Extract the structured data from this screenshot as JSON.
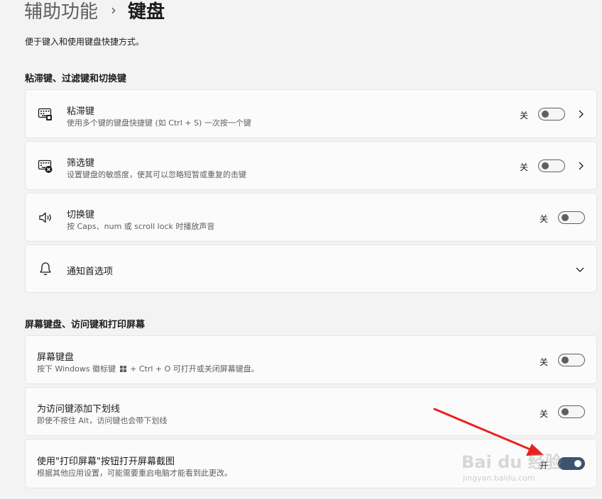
{
  "breadcrumb": {
    "parent": "辅助功能",
    "separator": "›",
    "current": "键盘"
  },
  "description": "便于键入和使用键盘快捷方式。",
  "sections": [
    {
      "title": "粘滞键、过滤键和切换键"
    },
    {
      "title": "屏幕键盘、访问键和打印屏幕"
    }
  ],
  "settings": {
    "sticky_keys": {
      "title": "粘滞键",
      "subtitle": "使用多个键的键盘快捷键 (如 Ctrl + S) 一次按一个键",
      "state": "关",
      "icon": "sticky-keys-icon",
      "on": false
    },
    "filter_keys": {
      "title": "筛选键",
      "subtitle": "设置键盘的敏感度，使其可以忽略短暂或重复的击键",
      "state": "关",
      "icon": "filter-keys-icon",
      "on": false
    },
    "toggle_keys": {
      "title": "切换键",
      "subtitle": "按 Caps、num 或 scroll lock 时播放声音",
      "state": "关",
      "icon": "speaker-icon",
      "on": false
    },
    "notifications": {
      "title": "通知首选项",
      "icon": "bell-icon"
    },
    "osk": {
      "title": "屏幕键盘",
      "subtitle_before": "按下 Windows 徽标键",
      "subtitle_after": "+ Ctrl + O 可打开或关闭屏幕键盘。",
      "state": "关",
      "on": false
    },
    "underline_access": {
      "title": "为访问键添加下划线",
      "subtitle": "即使不按住 Alt，访问键也会带下划线",
      "state": "关",
      "on": false
    },
    "print_screen": {
      "title": "使用\"打印屏幕\"按钮打开屏幕截图",
      "subtitle": "根据其他应用设置，可能需要重启电脑才能看到此更改。",
      "state": "开",
      "on": true
    }
  },
  "watermark": {
    "text": "Bai du 经验",
    "url": "jingyan.baidu.com"
  },
  "annotation": {
    "color": "#e8231e"
  }
}
